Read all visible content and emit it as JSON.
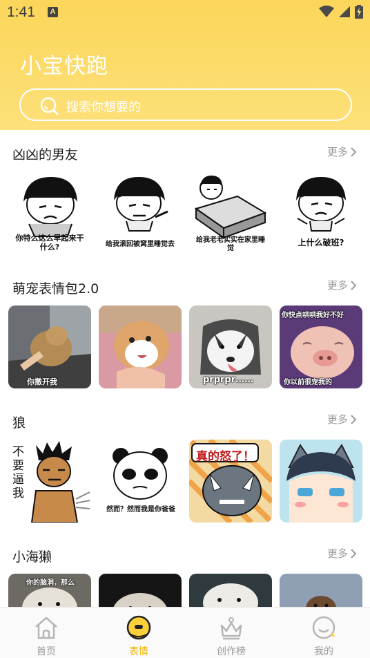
{
  "status": {
    "time": "1:41",
    "notif_letter": "A"
  },
  "app": {
    "title": "小宝快跑"
  },
  "search": {
    "placeholder": "搜索你想要的"
  },
  "sections": [
    {
      "title": "凶凶的男友",
      "more": "更多",
      "items": [
        {
          "caption": "你特么这么早起来干什么?"
        },
        {
          "caption": "给我滚回被窝里睡觉去"
        },
        {
          "caption": "给我老老实实在家里睡觉"
        },
        {
          "caption": "上什么破班?"
        }
      ]
    },
    {
      "title": "萌宠表情包2.0",
      "more": "更多",
      "items": [
        {
          "caption": "你撒开我"
        },
        {
          "caption": ""
        },
        {
          "caption": "prprpr……"
        },
        {
          "caption": "你快点哄哄我好不好",
          "caption2": "你以前很宠我的"
        }
      ]
    },
    {
      "title": "狼",
      "more": "更多",
      "items": [
        {
          "caption": "不要逼我"
        },
        {
          "caption": "然而？然而我是你爸爸"
        },
        {
          "caption": "真的怒了！"
        },
        {
          "caption": ""
        }
      ]
    },
    {
      "title": "小海獭",
      "more": "更多",
      "items": [
        {
          "caption": "你的脑洞，那么"
        },
        {
          "caption": ""
        },
        {
          "caption": ""
        },
        {
          "caption": ""
        }
      ]
    }
  ],
  "tabs": [
    {
      "label": "首页",
      "icon": "home-icon"
    },
    {
      "label": "表情",
      "icon": "emoji-icon",
      "active": true
    },
    {
      "label": "创作榜",
      "icon": "crown-icon"
    },
    {
      "label": "我的",
      "icon": "profile-icon"
    }
  ],
  "colors": {
    "accent": "#fbd65a",
    "active_tab": "#f0b400"
  }
}
